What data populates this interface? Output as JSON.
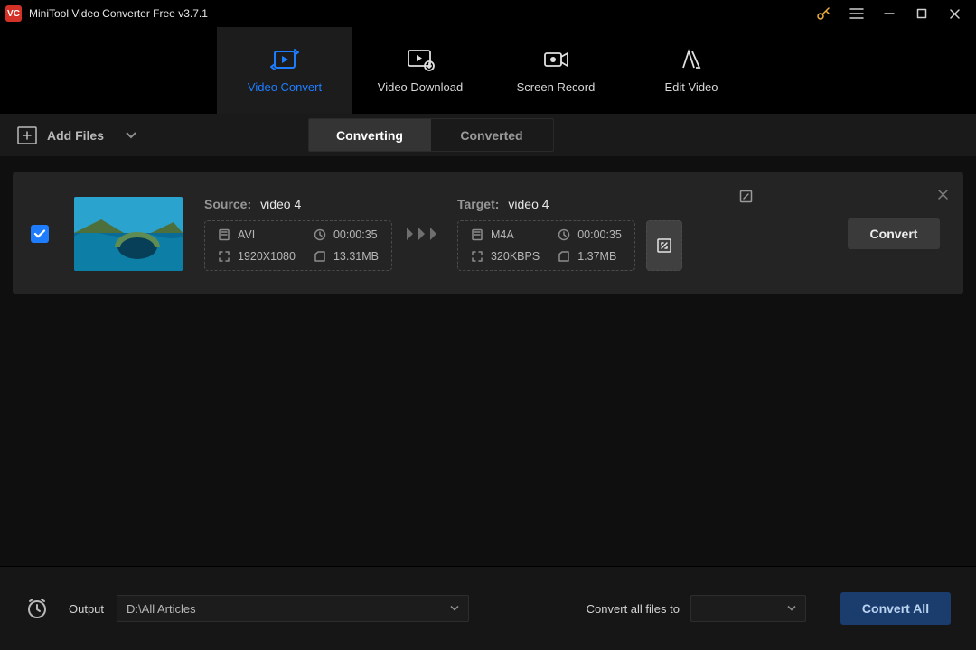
{
  "app": {
    "icon_letters": "VC",
    "title": "MiniTool Video Converter Free v3.7.1"
  },
  "nav": {
    "tabs": [
      {
        "id": "video-convert",
        "label": "Video Convert",
        "active": true
      },
      {
        "id": "video-download",
        "label": "Video Download",
        "active": false
      },
      {
        "id": "screen-record",
        "label": "Screen Record",
        "active": false
      },
      {
        "id": "edit-video",
        "label": "Edit Video",
        "active": false
      }
    ]
  },
  "toolbar": {
    "add_files_label": "Add Files",
    "segments": {
      "converting": "Converting",
      "converted": "Converted"
    },
    "active_segment": "converting"
  },
  "items": [
    {
      "checked": true,
      "source": {
        "label": "Source:",
        "filename": "video 4",
        "format": "AVI",
        "duration": "00:00:35",
        "resolution": "1920X1080",
        "filesize": "13.31MB"
      },
      "target": {
        "label": "Target:",
        "filename": "video 4",
        "format": "M4A",
        "duration": "00:00:35",
        "bitrate": "320KBPS",
        "filesize": "1.37MB"
      },
      "convert_label": "Convert"
    }
  ],
  "footer": {
    "output_label": "Output",
    "output_path": "D:\\All Articles",
    "convert_all_to_label": "Convert all files to",
    "convert_all_to_value": "",
    "convert_all_label": "Convert All"
  },
  "colors": {
    "accent": "#1e7dff",
    "brand": "#d43128"
  }
}
